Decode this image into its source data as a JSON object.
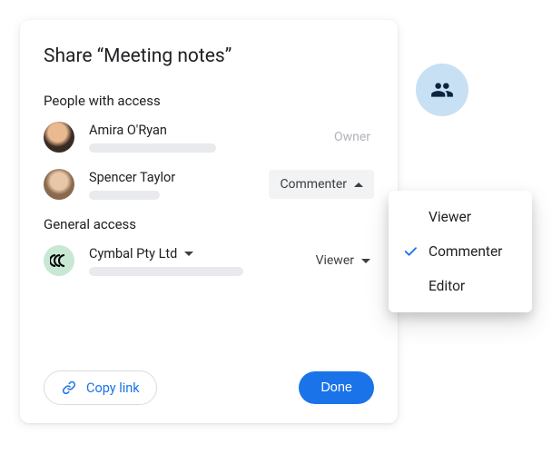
{
  "dialog": {
    "title": "Share “Meeting notes”",
    "people_label": "People with access",
    "general_label": "General access"
  },
  "people": [
    {
      "name": "Amira O'Ryan",
      "role": "Owner",
      "role_type": "static"
    },
    {
      "name": "Spencer Taylor",
      "role": "Commenter",
      "role_type": "dropdown_open"
    }
  ],
  "org": {
    "name": "Cymbal Pty Ltd",
    "role": "Viewer"
  },
  "footer": {
    "copy_link": "Copy link",
    "done": "Done"
  },
  "role_menu": {
    "options": [
      "Viewer",
      "Commenter",
      "Editor"
    ],
    "selected": "Commenter"
  },
  "icons": {
    "group": "group-icon",
    "link": "link-icon",
    "org_mark": "ⓜ"
  },
  "colors": {
    "primary": "#1a73e8",
    "badge_bg": "#c7e0f4",
    "chip_bg": "#f1f3f4"
  }
}
